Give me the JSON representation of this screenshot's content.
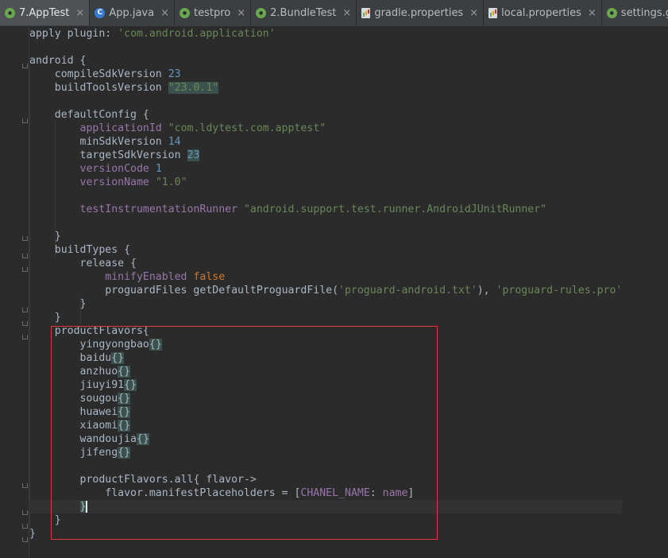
{
  "tabs": [
    {
      "label": "7.AppTest",
      "icon": "gradle-icon",
      "active": true
    },
    {
      "label": "App.java",
      "icon": "java-class-icon",
      "active": false
    },
    {
      "label": "testpro",
      "icon": "gradle-icon",
      "active": false
    },
    {
      "label": "2.BundleTest",
      "icon": "gradle-icon",
      "active": false
    },
    {
      "label": "gradle.properties",
      "icon": "properties-file-icon",
      "active": false
    },
    {
      "label": "local.properties",
      "icon": "properties-file-icon",
      "active": false
    },
    {
      "label": "settings.gradle",
      "icon": "gradle-icon",
      "active": false
    }
  ],
  "close_glyph": "×",
  "java_icon_letter": "C",
  "code": {
    "apply": "apply",
    "plugin_key": "plugin:",
    "plugin_val": "'com.android.application'",
    "android": "android {",
    "compileSdkVersion": "compileSdkVersion",
    "compileSdk_val": "23",
    "buildToolsVersion": "buildToolsVersion",
    "buildTools_val": "\"23.0.1\"",
    "defaultConfig": "defaultConfig {",
    "applicationId": "applicationId",
    "applicationId_val": "\"com.ldytest.com.apptest\"",
    "minSdkVersion": "minSdkVersion",
    "minSdk_val": "14",
    "targetSdkVersion": "targetSdkVersion",
    "targetSdk_val": "23",
    "versionCode": "versionCode",
    "versionCode_val": "1",
    "versionName": "versionName",
    "versionName_val": "\"1.0\"",
    "testRunner": "testInstrumentationRunner",
    "testRunner_val": "\"android.support.test.runner.AndroidJUnitRunner\"",
    "close_brace": "}",
    "buildTypes": "buildTypes {",
    "release": "release {",
    "minifyEnabled": "minifyEnabled",
    "false": "false",
    "proguardFiles": "proguardFiles getDefaultProguardFile(",
    "proguard_android": "'proguard-android.txt'",
    "proguard_sep": "), ",
    "proguard_rules": "'proguard-rules.pro'",
    "productFlavors": "productFlavors{",
    "flavors": [
      "yingyongbao",
      "baidu",
      "anzhuo",
      "jiuyi91",
      "sougou",
      "huawei",
      "xiaomi",
      "wandoujia",
      "jifeng"
    ],
    "empty_braces": "{}",
    "flavors_all": "productFlavors.all",
    "flavor_lambda": "{ flavor->",
    "manifest": "flavor.manifestPlaceholders = [",
    "chanel_key": "CHANEL_NAME",
    "colon": ": ",
    "name": "name",
    "close_bracket": "]"
  }
}
